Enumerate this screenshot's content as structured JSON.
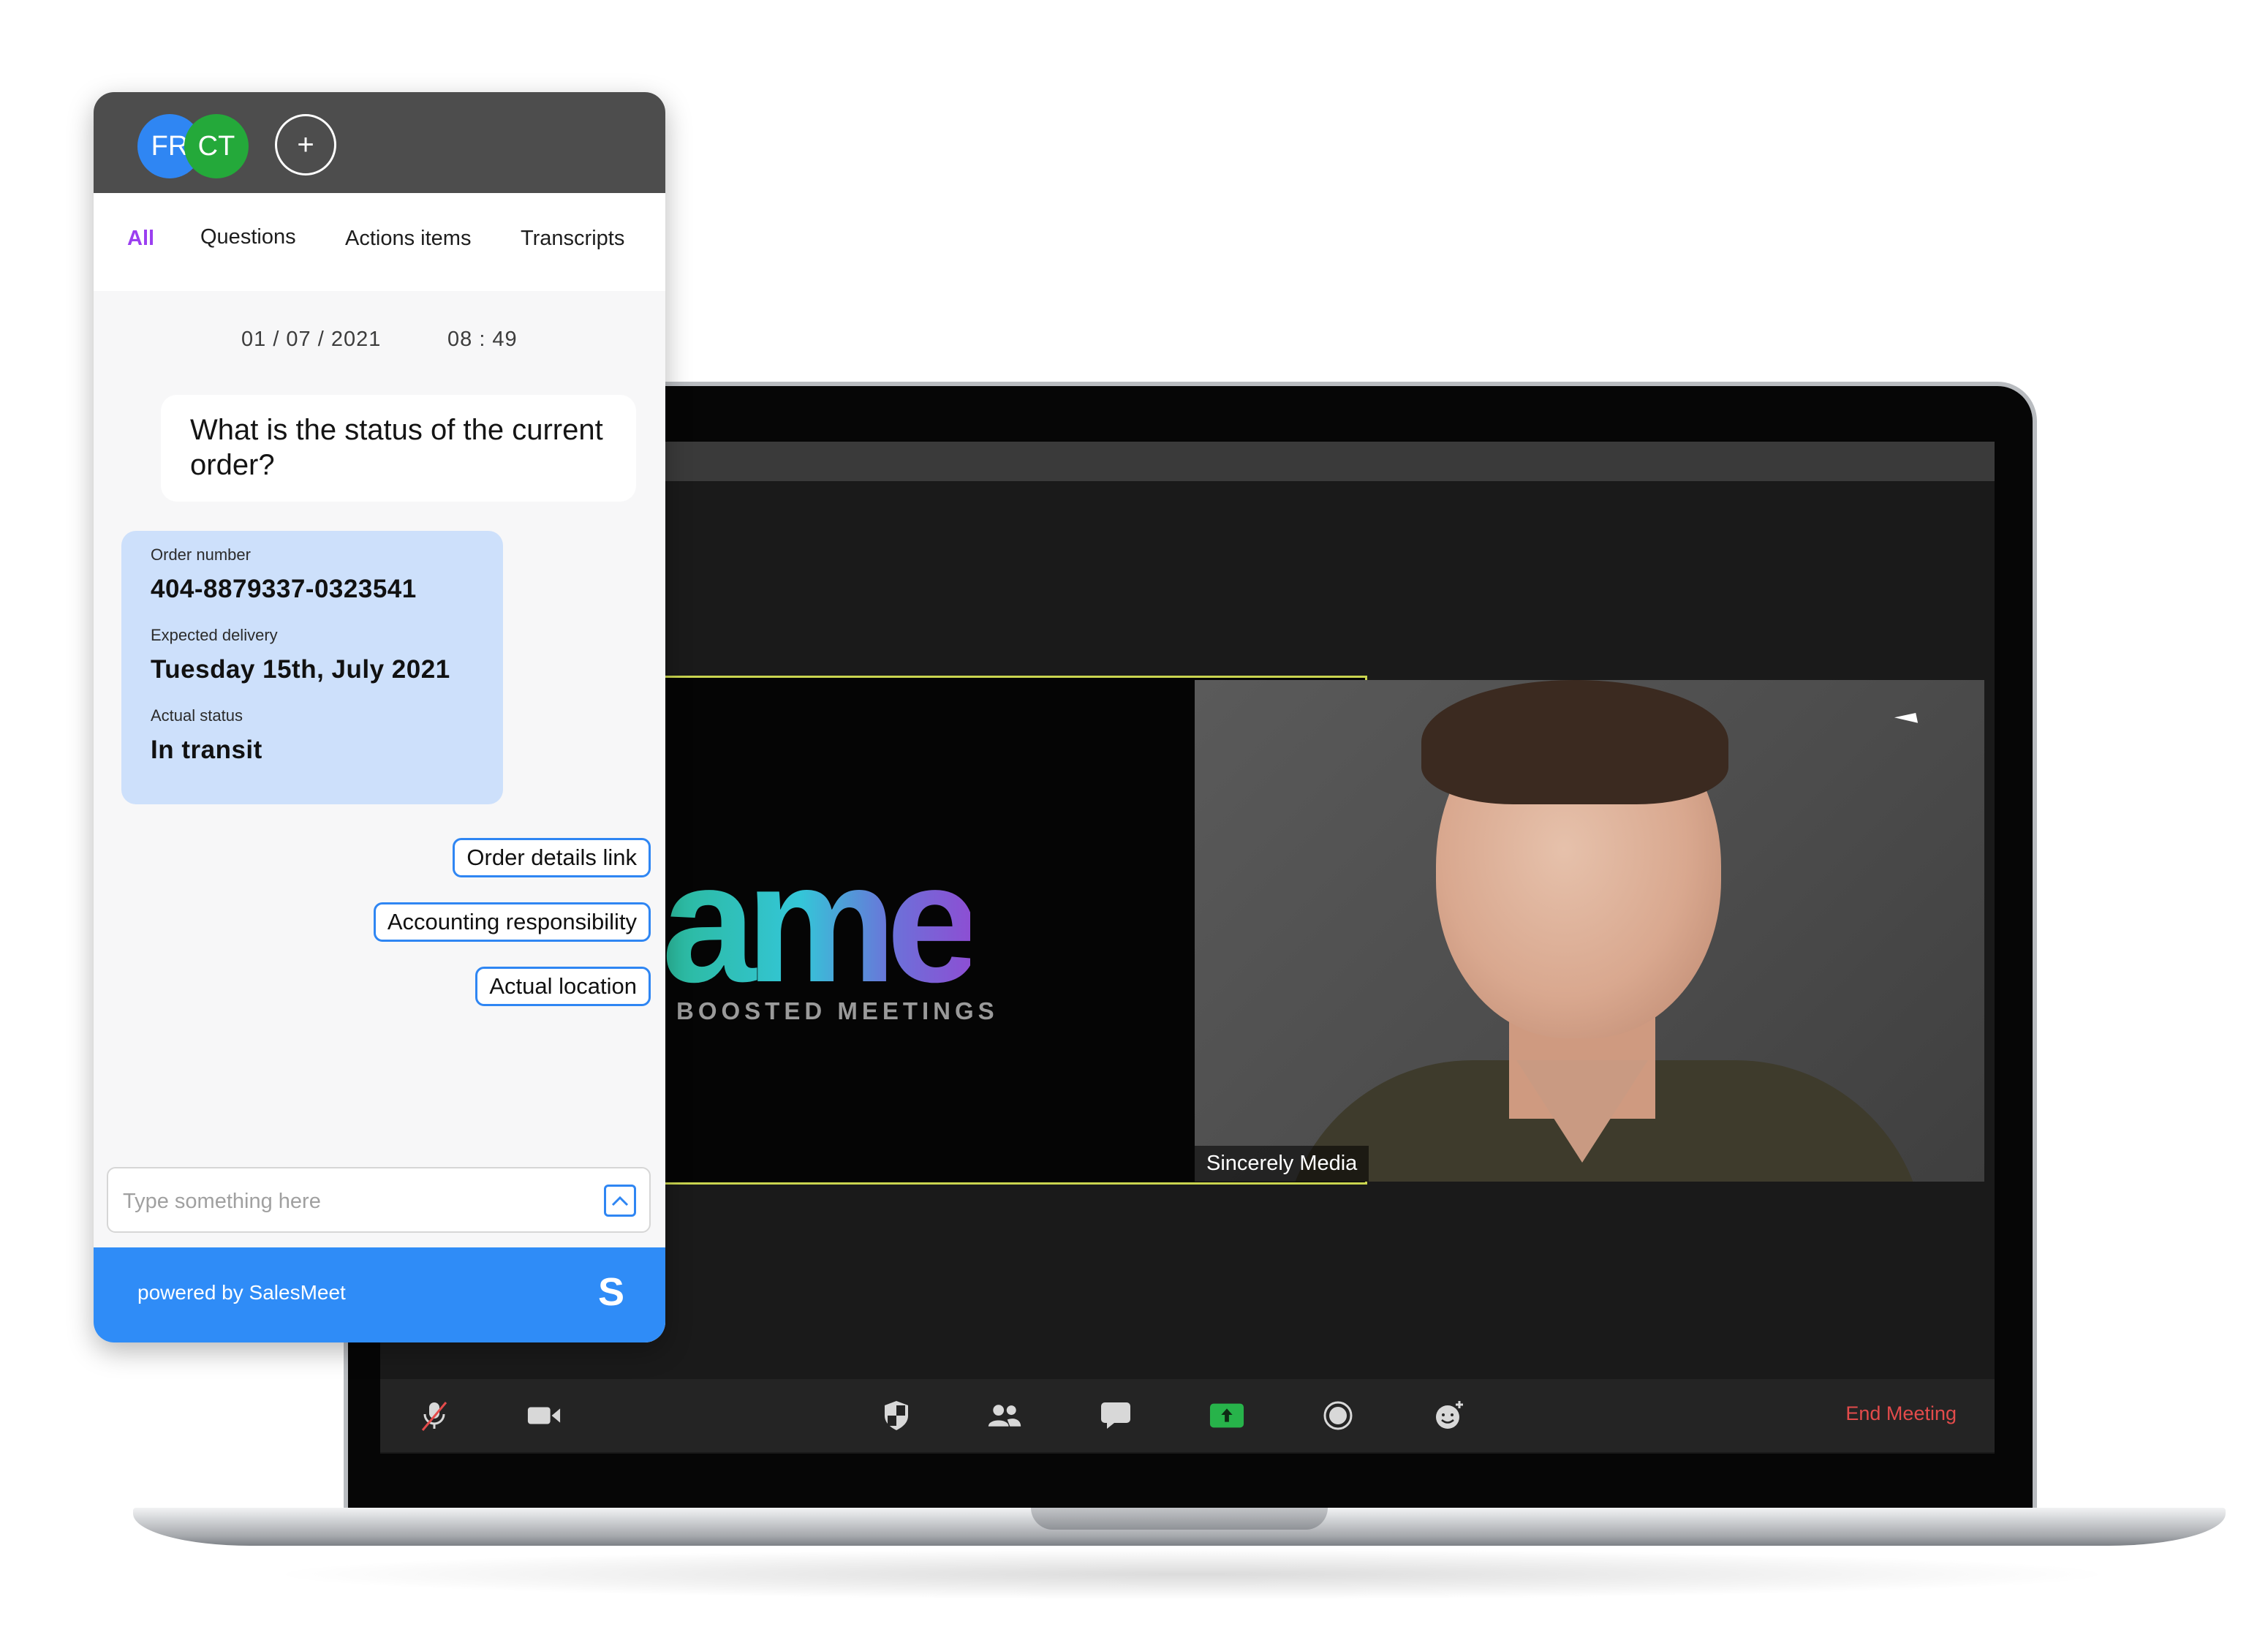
{
  "panel": {
    "avatars": [
      "FR",
      "CT"
    ],
    "add_label": "+",
    "tabs": [
      "All",
      "Questions",
      "Actions items",
      "Transcripts"
    ],
    "date": "01 / 07 / 2021",
    "time": "08 : 49",
    "question": "What is the status of the current order?",
    "order": {
      "number_label": "Order number",
      "number": "404-8879337-0323541",
      "delivery_label": "Expected delivery",
      "delivery": "Tuesday 15th, July 2021",
      "status_label": "Actual status",
      "status": "In transit"
    },
    "chips": [
      "Order details link",
      "Accounting responsibility",
      "Actual location"
    ],
    "input_placeholder": "Type something here",
    "footer_text": "powered by SalesMeet",
    "footer_logo": "S"
  },
  "meeting": {
    "logo_text": "ame",
    "logo_subtitle": "BOOSTED MEETINGS",
    "participant_name": "Sincerely Media",
    "end_meeting": "End Meeting",
    "toolbar_icons": [
      "mic-muted-icon",
      "video-camera-icon",
      "security-shield-icon",
      "participants-icon",
      "chat-icon",
      "share-screen-icon",
      "record-icon",
      "reactions-icon"
    ]
  },
  "colors": {
    "accent_blue": "#2f8cf7",
    "tab_active": "#9b3ff0",
    "card_bg": "#cde0fb",
    "end_meeting": "#e34b4b",
    "share_green": "#27b34a"
  }
}
